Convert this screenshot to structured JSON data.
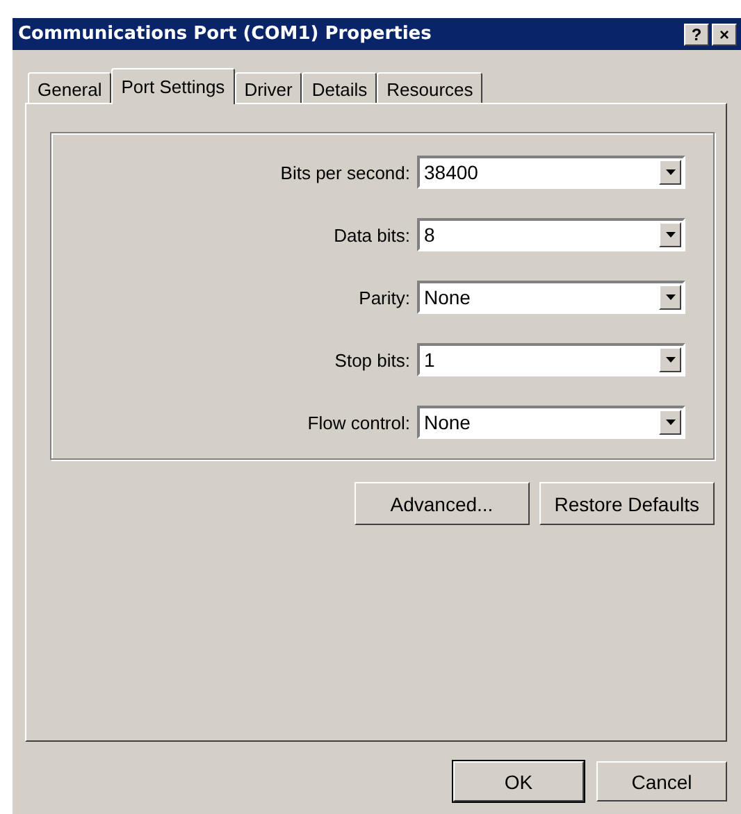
{
  "window": {
    "title": "Communications Port (COM1) Properties",
    "title_buttons": [
      "?",
      "×"
    ]
  },
  "tabs": [
    {
      "label": "General",
      "selected": false
    },
    {
      "label": "Port Settings",
      "selected": true
    },
    {
      "label": "Driver",
      "selected": false
    },
    {
      "label": "Details",
      "selected": false
    },
    {
      "label": "Resources",
      "selected": false
    }
  ],
  "settings": [
    {
      "label": "Bits per second:",
      "value": "38400"
    },
    {
      "label": "Data bits:",
      "value": "8"
    },
    {
      "label": "Parity:",
      "value": "None"
    },
    {
      "label": "Stop bits:",
      "value": "1"
    },
    {
      "label": "Flow control:",
      "value": "None"
    }
  ],
  "panel_buttons": [
    "Advanced...",
    "Restore Defaults"
  ],
  "buttons": [
    {
      "label": "OK",
      "default": true
    },
    {
      "label": "Cancel",
      "default": false
    }
  ]
}
